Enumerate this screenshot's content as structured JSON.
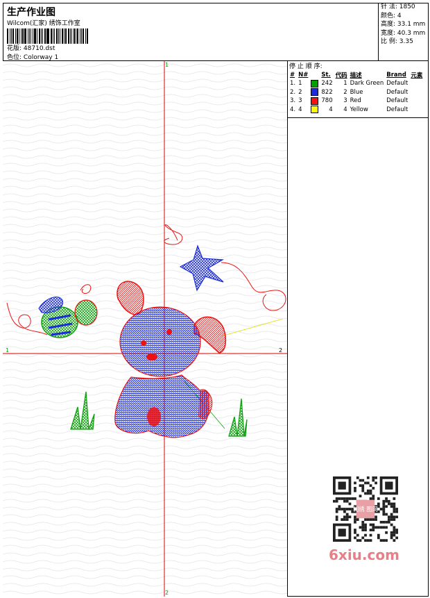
{
  "header": {
    "title": "生产作业图",
    "studio": "Wilcom(汇家) 绣饰工作室",
    "design_label": "花版:",
    "design_value": "48710.dst",
    "colorway_label": "色位:",
    "colorway_value": "Colorway 1"
  },
  "stats": {
    "stitches": "针 法: 1850",
    "colors": "颜色: 4",
    "height": "高度: 33.1 mm",
    "width": "宽度: 40.3 mm",
    "scale": "比 例: 3.35"
  },
  "stop_sequence": {
    "heading": "停 止 顺 序:",
    "columns": [
      "#",
      "N#",
      "St.",
      "代码",
      "描述",
      "Brand",
      "元素"
    ],
    "rows": [
      {
        "idx": "1.",
        "n": "1",
        "color": "#00a000",
        "st": "242",
        "code": "1",
        "desc": "Dark Green",
        "brand": "Default"
      },
      {
        "idx": "2.",
        "n": "2",
        "color": "#1c2cd8",
        "st": "822",
        "code": "2",
        "desc": "Blue",
        "brand": "Default"
      },
      {
        "idx": "3.",
        "n": "3",
        "color": "#ff1010",
        "st": "780",
        "code": "3",
        "desc": "Red",
        "brand": "Default"
      },
      {
        "idx": "4.",
        "n": "4",
        "color": "#ffff00",
        "st": "4",
        "code": "4",
        "desc": "Yellow",
        "brand": "Default"
      }
    ]
  },
  "axes": {
    "top": "1",
    "bottom": "2",
    "left": "1",
    "right": "2"
  },
  "colors": {
    "green": "#10a010",
    "blue": "#1c2cd8",
    "red": "#ee1111",
    "yellow": "#e0e000",
    "axis": "#dd0000"
  },
  "watermark": "6xiu.com",
  "qr_center_text": "刺绣 图网"
}
